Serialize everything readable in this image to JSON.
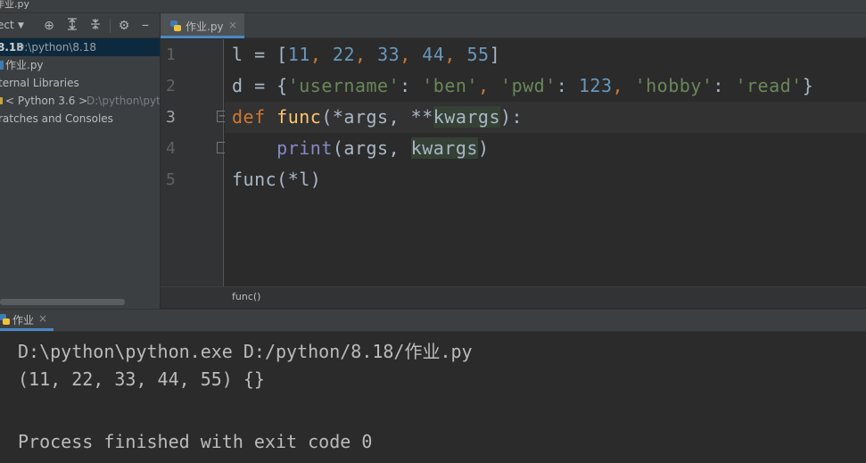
{
  "window": {
    "title": "作业.py"
  },
  "project_panel": {
    "selector_label": "ect",
    "tree": [
      {
        "name": "8.18",
        "path": "D:\\python\\8.18"
      },
      {
        "name": "作业.py"
      },
      {
        "name": "ternal Libraries"
      },
      {
        "name": "< Python 3.6 >",
        "path": "D:\\python\\pyth"
      },
      {
        "name": "ratches and Consoles"
      }
    ]
  },
  "editor": {
    "tab": {
      "label": "作业.py"
    },
    "active_line": 3,
    "line_numbers": [
      "1",
      "2",
      "3",
      "4",
      "5"
    ],
    "code": {
      "line1": {
        "var": "l",
        "eq": " = ",
        "lb": "[",
        "n1": "11",
        "n2": "22",
        "n3": "33",
        "n4": "44",
        "n5": "55",
        "rb": "]",
        "sep": ", "
      },
      "line2": {
        "var": "d",
        "eq": " = ",
        "lb": "{",
        "k1": "'username'",
        "v1": "'ben'",
        "k2": "'pwd'",
        "v2": "123",
        "k3": "'hobby'",
        "v3": "'read'",
        "rb": "}",
        "colon": ": ",
        "sep": ", "
      },
      "line3": {
        "kw": "def",
        "sp": " ",
        "fn": "func",
        "open": "(*args, **",
        "param": "kwargs",
        "close": "):"
      },
      "line4": {
        "indent": "    ",
        "bi": "print",
        "open": "(args, ",
        "param": "kwargs",
        "close": ")"
      },
      "line5": {
        "text": "func(*l)"
      }
    },
    "breadcrumb": "func()"
  },
  "run_panel": {
    "tab_label": "作业",
    "output": [
      "D:\\python\\python.exe D:/python/8.18/作业.py",
      "(11, 22, 33, 44, 55) {}",
      "",
      "Process finished with exit code 0"
    ]
  },
  "colors": {
    "background": "#2b2b2b",
    "panel": "#3c3f41",
    "keyword": "#cc7832",
    "function": "#ffc66d",
    "number": "#6897bb",
    "string": "#6a8759",
    "builtin": "#8888c6",
    "accent": "#4a88c7"
  }
}
